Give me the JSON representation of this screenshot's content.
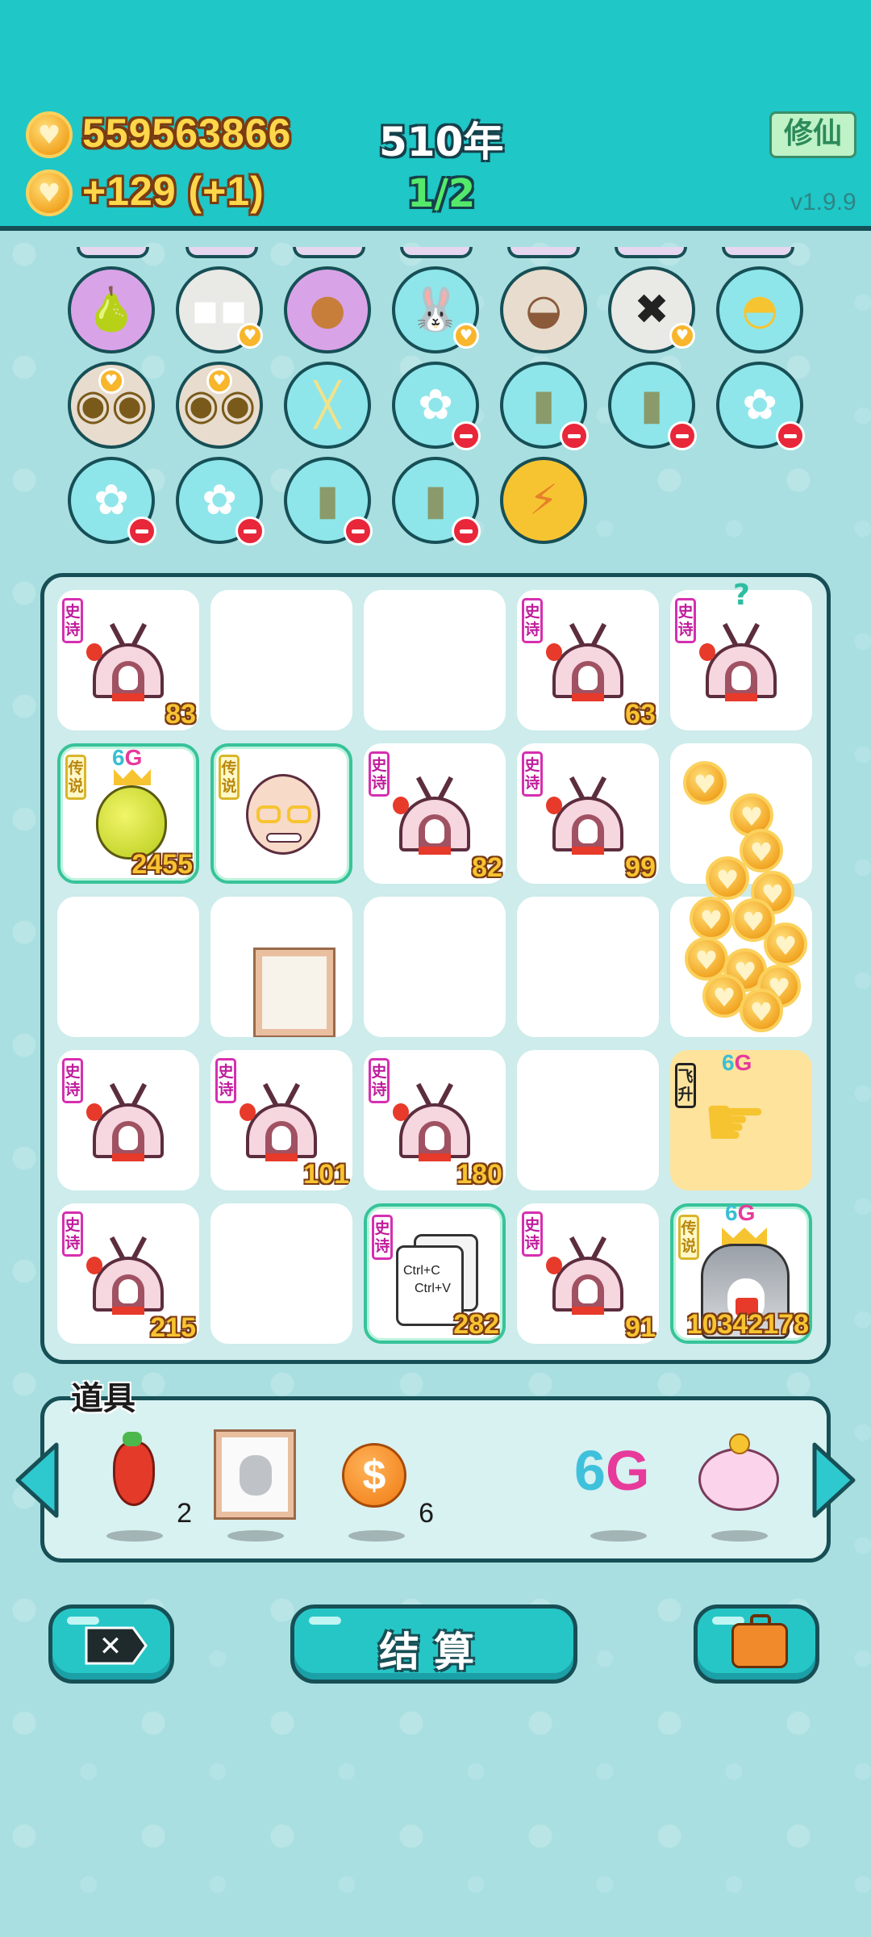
{
  "header": {
    "coins": "559563866",
    "income": "+129 (+1)",
    "year": "510年",
    "wave": "1/2",
    "mode_button": "修仙",
    "version": "v1.9.9"
  },
  "upgrades": [
    {
      "name": "pomelo-icon",
      "badge": "none"
    },
    {
      "name": "sugar-cubes-icon",
      "badge": "heart"
    },
    {
      "name": "bindle-icon",
      "badge": "none"
    },
    {
      "name": "bunny-icon",
      "badge": "heart"
    },
    {
      "name": "dog-bowl-icon",
      "badge": "none"
    },
    {
      "name": "delete-tag-icon",
      "badge": "heart"
    },
    {
      "name": "pot-duck-icon",
      "badge": "none"
    },
    {
      "name": "owl-pair-icon",
      "badge": "none"
    },
    {
      "name": "owl-pair-icon",
      "badge": "none"
    },
    {
      "name": "chopsticks-icon",
      "badge": "none"
    },
    {
      "name": "potted-flower-icon",
      "badge": "minus"
    },
    {
      "name": "seed-bag-icon",
      "badge": "minus"
    },
    {
      "name": "seed-bag-icon",
      "badge": "minus"
    },
    {
      "name": "potted-flower-icon",
      "badge": "minus"
    },
    {
      "name": "potted-flower-icon",
      "badge": "minus"
    },
    {
      "name": "potted-flower-icon",
      "badge": "minus"
    },
    {
      "name": "seed-bag-icon",
      "badge": "minus"
    },
    {
      "name": "seed-bag-icon",
      "badge": "minus"
    },
    {
      "name": "lightning-icon",
      "badge": "none"
    }
  ],
  "board": {
    "rarity_epic": "史诗",
    "rarity_legend": "传说",
    "rarity_fly": "飞升",
    "sixg_six": "6",
    "sixg_g": "G",
    "question": "?",
    "copy_line1": "Ctrl+C",
    "copy_line2": "Ctrl+V",
    "counts": {
      "r1c1": "83",
      "r1c4": "63",
      "r2c1": "2455",
      "r2c3": "82",
      "r2c4": "99",
      "r4c2": "101",
      "r4c3": "180",
      "r5c1": "215",
      "r5c3": "282",
      "r5c4": "91",
      "r5c5": "10342178"
    }
  },
  "items": {
    "title": "道具",
    "list": [
      {
        "name": "chili-pepper-icon",
        "qty": "2"
      },
      {
        "name": "frame-cat-icon",
        "qty": ""
      },
      {
        "name": "dollar-coin-icon",
        "qty": "6"
      },
      {
        "name": "six-g-icon",
        "qty": ""
      },
      {
        "name": "piggy-bank-icon",
        "qty": ""
      }
    ],
    "sixg_six": "6",
    "sixg_g": "G"
  },
  "buttons": {
    "settle": "结算"
  },
  "colors": {
    "header_bg": "#1fc7c7",
    "page_bg": "#a9dfe0",
    "outline": "#174f56",
    "gold": "#ffd74a",
    "epic": "#d62fb0",
    "legend": "#d9b52a"
  }
}
